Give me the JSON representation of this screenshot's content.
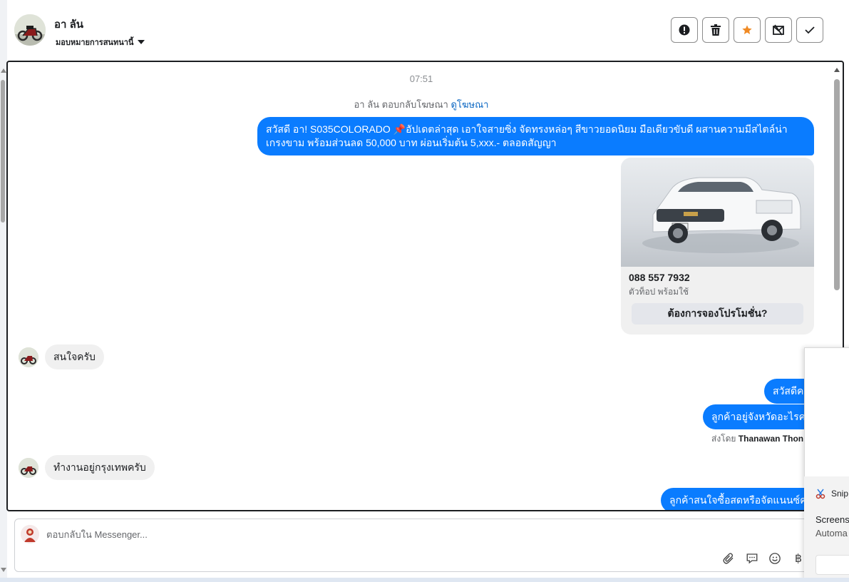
{
  "header": {
    "contact_name": "อา ลัน",
    "assign_label": "มอบหมายการสนทนานี้",
    "actions": [
      "alert-icon",
      "trash-icon",
      "star-icon",
      "spam-icon",
      "check-icon"
    ]
  },
  "chat": {
    "timestamp": "07:51",
    "reply_note": "อา ลัน ตอบกลับโฆษณา",
    "reply_note_link": "ดูโฆษณา",
    "messages": [
      {
        "dir": "out",
        "text": "สวัสดี อา! S035COLORADO 📌อัปเดตล่าสุด เอาใจสายซิ่ง จัดทรงหล่อๆ สีขาวยอดนิยม มือเดียวขับดี ผสานความมีสไตล์น่าเกรงขาม พร้อมส่วนลด 50,000 บาท ผ่อนเริ่มต้น 5,xxx.- ตลอดสัญญา"
      },
      {
        "dir": "in",
        "text": "สนใจครับ"
      },
      {
        "dir": "out",
        "text": "สวัสดีคะ"
      },
      {
        "dir": "out",
        "text": "ลูกค้าอยู่จังหวัดอะไรคะ"
      },
      {
        "dir": "in",
        "text": "ทำงานอยู่กรุงเทพครับ"
      },
      {
        "dir": "out",
        "text": "ลูกค้าสนใจซื้อสดหรือจัดแนนซ์คะ"
      }
    ],
    "card": {
      "title": "088 557 7932",
      "subtitle": "ตัวท็อป พร้อมใช้",
      "button_label": "ต้องการจองโปรโมชั่น?"
    },
    "sent_by_prefix": "ส่งโดย",
    "sent_by_name": "Thanawan Thon"
  },
  "composer": {
    "placeholder": "ตอบกลับใน Messenger...",
    "tools": [
      "attach-icon",
      "comment-icon",
      "emoji-icon",
      "baht-icon"
    ],
    "baht_symbol": "฿"
  },
  "notification": {
    "app_name": "Snip",
    "line1": "Screens",
    "line2": "Automa"
  }
}
